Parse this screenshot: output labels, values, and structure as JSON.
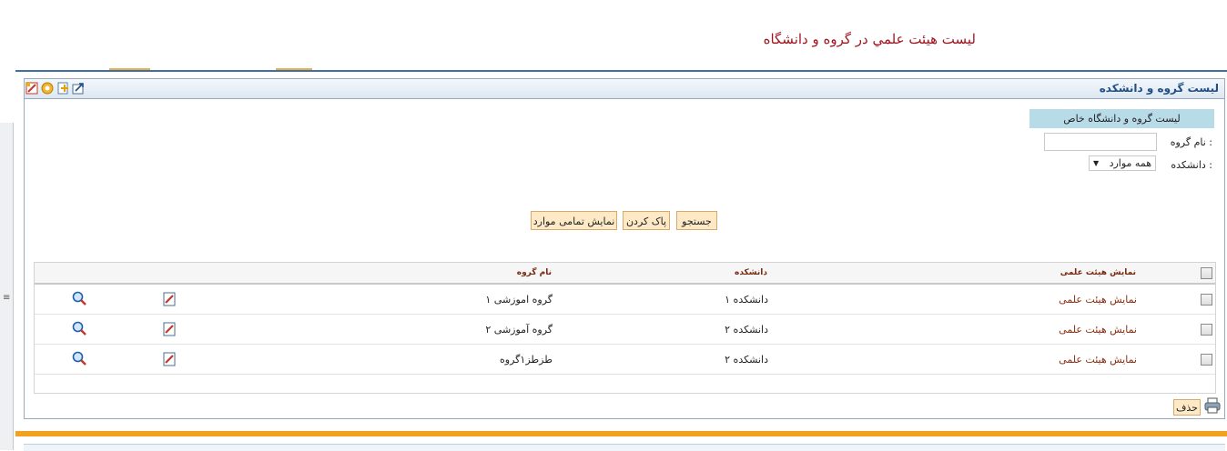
{
  "page": {
    "title": "ليست هيئت علمي در گروه و دانشگاه"
  },
  "panel": {
    "title": "لیست گروه و دانشکده"
  },
  "toolbar": {
    "icons": [
      "export-icon",
      "add-icon",
      "settings-icon",
      "edit-icon"
    ]
  },
  "filter": {
    "section_title": "لیست گروه و دانشگاه خاص",
    "group_label": "نام گروه  :",
    "group_value": "",
    "college_label": "دانشکده :",
    "college_selected": "همه موارد"
  },
  "buttons": {
    "search": "جستجو",
    "clear": "پاک کردن",
    "show_all": "نمایش تمامی موارد",
    "delete": "حذف"
  },
  "table": {
    "headers": {
      "show": "نمایش هیئت علمی",
      "college": "دانشکده",
      "group": "نام گروه"
    },
    "rows": [
      {
        "show": "نمایش هیئت علمی",
        "college": "دانشکده ۱",
        "group": "گروه اموزشی ۱"
      },
      {
        "show": "نمایش هیئت علمی",
        "college": "دانشکده ۲",
        "group": "گروه آموزشی ۲"
      },
      {
        "show": "نمایش هیئت علمی",
        "college": "دانشکده ۲",
        "group": "طزطز۱گروه"
      }
    ]
  },
  "colors": {
    "accent": "#f3a21f",
    "title": "#a0141e",
    "link": "#8a2b12",
    "header_bg": "#b8dbe8"
  }
}
